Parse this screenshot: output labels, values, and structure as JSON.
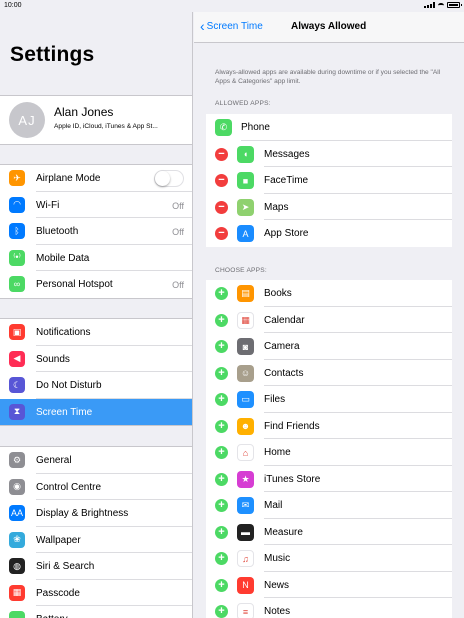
{
  "status": {
    "time": "10:00"
  },
  "left": {
    "title": "Settings",
    "profile": {
      "initials": "AJ",
      "name": "Alan Jones",
      "subtitle": "Apple ID, iCloud, iTunes & App St..."
    },
    "group1": [
      {
        "label": "Airplane Mode",
        "icon": "airplane-icon",
        "color": "#ff9500",
        "glyph": "✈",
        "toggle": true
      },
      {
        "label": "Wi-Fi",
        "icon": "wifi-icon",
        "color": "#007aff",
        "glyph": "◠",
        "value": "Off"
      },
      {
        "label": "Bluetooth",
        "icon": "bluetooth-icon",
        "color": "#007aff",
        "glyph": "ᛒ",
        "value": "Off"
      },
      {
        "label": "Mobile Data",
        "icon": "antenna-icon",
        "color": "#4cd964",
        "glyph": "⁽•⁾"
      },
      {
        "label": "Personal Hotspot",
        "icon": "hotspot-icon",
        "color": "#4cd964",
        "glyph": "∞",
        "value": "Off"
      }
    ],
    "group2": [
      {
        "label": "Notifications",
        "icon": "notifications-icon",
        "color": "#ff3b30",
        "glyph": "▣"
      },
      {
        "label": "Sounds",
        "icon": "speaker-icon",
        "color": "#ff2d55",
        "glyph": "◀"
      },
      {
        "label": "Do Not Disturb",
        "icon": "moon-icon",
        "color": "#5856d6",
        "glyph": "☾"
      },
      {
        "label": "Screen Time",
        "icon": "hourglass-icon",
        "color": "#5856d6",
        "glyph": "⧗",
        "selected": true
      }
    ],
    "group3": [
      {
        "label": "General",
        "icon": "gear-icon",
        "color": "#8e8e93",
        "glyph": "⚙"
      },
      {
        "label": "Control Centre",
        "icon": "switches-icon",
        "color": "#8e8e93",
        "glyph": "◉"
      },
      {
        "label": "Display & Brightness",
        "icon": "display-icon",
        "color": "#007aff",
        "glyph": "AA"
      },
      {
        "label": "Wallpaper",
        "icon": "wallpaper-icon",
        "color": "#34aadc",
        "glyph": "❀"
      },
      {
        "label": "Siri & Search",
        "icon": "siri-icon",
        "color": "#222222",
        "glyph": "◍"
      },
      {
        "label": "Passcode",
        "icon": "passcode-icon",
        "color": "#ff3b30",
        "glyph": "▦"
      },
      {
        "label": "Battery",
        "icon": "battery-icon",
        "color": "#4cd964",
        "glyph": "▬"
      }
    ]
  },
  "right": {
    "back_label": "Screen Time",
    "title": "Always Allowed",
    "description": "Always-allowed apps are available during downtime or if you selected the \"All Apps & Categories\" app limit.",
    "allowed_header": "ALLOWED APPS:",
    "allowed": [
      {
        "label": "Phone",
        "icon": "phone-icon",
        "color": "#4cd964",
        "glyph": "✆",
        "removable": false
      },
      {
        "label": "Messages",
        "icon": "messages-icon",
        "color": "#4cd964",
        "glyph": "◖",
        "removable": true
      },
      {
        "label": "FaceTime",
        "icon": "facetime-icon",
        "color": "#4cd964",
        "glyph": "■",
        "removable": true
      },
      {
        "label": "Maps",
        "icon": "maps-icon",
        "color": "#8fd16f",
        "glyph": "➤",
        "removable": true
      },
      {
        "label": "App Store",
        "icon": "appstore-icon",
        "color": "#1a8cff",
        "glyph": "A",
        "removable": true
      }
    ],
    "choose_header": "CHOOSE APPS:",
    "choose": [
      {
        "label": "Books",
        "icon": "books-icon",
        "color": "#ff9500",
        "glyph": "▤"
      },
      {
        "label": "Calendar",
        "icon": "calendar-icon",
        "color": "#ffffff",
        "glyph": "▦"
      },
      {
        "label": "Camera",
        "icon": "camera-icon",
        "color": "#6d6d72",
        "glyph": "◙"
      },
      {
        "label": "Contacts",
        "icon": "contacts-icon",
        "color": "#a89f8c",
        "glyph": "☺"
      },
      {
        "label": "Files",
        "icon": "files-icon",
        "color": "#1e90ff",
        "glyph": "▭"
      },
      {
        "label": "Find Friends",
        "icon": "find-friends-icon",
        "color": "#ffb000",
        "glyph": "☻"
      },
      {
        "label": "Home",
        "icon": "home-icon",
        "color": "#ffffff",
        "glyph": "⌂"
      },
      {
        "label": "iTunes Store",
        "icon": "itunes-icon",
        "color": "#d63dd3",
        "glyph": "★"
      },
      {
        "label": "Mail",
        "icon": "mail-icon",
        "color": "#1e90ff",
        "glyph": "✉"
      },
      {
        "label": "Measure",
        "icon": "measure-icon",
        "color": "#222222",
        "glyph": "▬"
      },
      {
        "label": "Music",
        "icon": "music-icon",
        "color": "#ffffff",
        "glyph": "♫"
      },
      {
        "label": "News",
        "icon": "news-icon",
        "color": "#ff3b30",
        "glyph": "N"
      },
      {
        "label": "Notes",
        "icon": "notes-icon",
        "color": "#ffffff",
        "glyph": "≡"
      }
    ]
  }
}
